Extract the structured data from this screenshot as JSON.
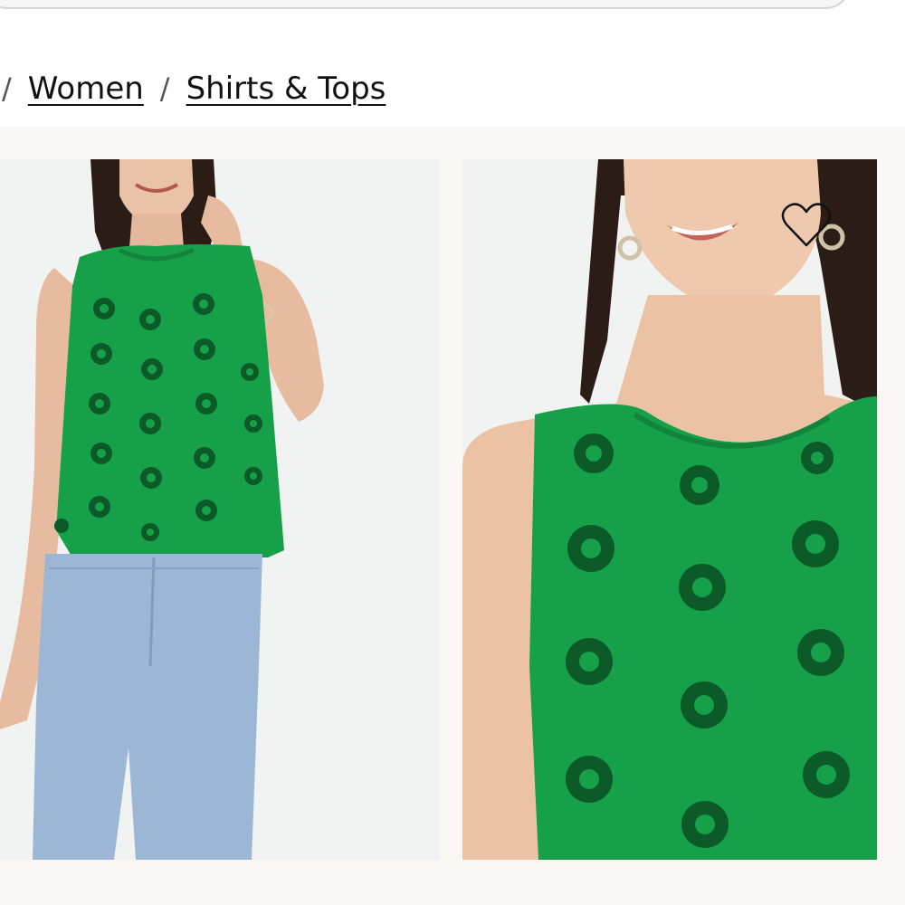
{
  "breadcrumb": {
    "separator": "/",
    "items": [
      {
        "label": "Women"
      },
      {
        "label": "Shirts & Tops"
      }
    ]
  },
  "product_images": [
    {
      "view": "full-body",
      "garment_color": "#17a04a"
    },
    {
      "view": "close-up",
      "garment_color": "#17a04a"
    }
  ],
  "wishlist": {
    "icon": "heart-outline-icon"
  },
  "colors": {
    "gallery_background": "#fbf7f4",
    "photo_background": "#f1f2f2",
    "garment_green": "#17a04a",
    "denim_blue": "#9cb7d6",
    "text": "#111111"
  }
}
